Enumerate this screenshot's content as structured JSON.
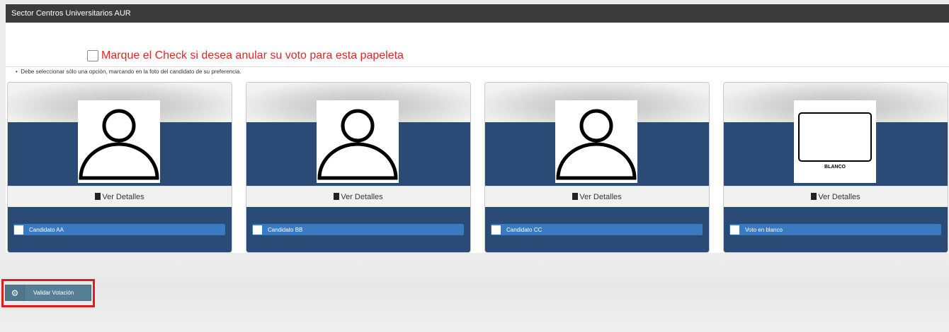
{
  "panel": {
    "title": "Sector Centros Universitarios AUR"
  },
  "annul": {
    "label": "Marque el Check si desea anular su voto para esta papeleta",
    "checked": false
  },
  "note": "Debe seleccionar sólo una opción, marcando en la foto del candidato de su preferencia.",
  "cards": [
    {
      "details_label": "Ver Detalles",
      "option_label": "Candidato AA",
      "photo_icon": "person-avatar-icon"
    },
    {
      "details_label": "Ver Detalles",
      "option_label": "Candidato BB",
      "photo_icon": "person-avatar-icon"
    },
    {
      "details_label": "Ver Detalles",
      "option_label": "Candidato CC",
      "photo_icon": "person-avatar-icon"
    },
    {
      "details_label": "Ver Detalles",
      "option_label": "Voto en blanco",
      "photo_icon": "blank-ballot-icon",
      "photo_text": "BLANCO"
    }
  ],
  "actions": {
    "validate_label": "Validar Votación",
    "validate_icon": "gear-icon"
  },
  "colors": {
    "header": "#3b3b3b",
    "navy": "#2a4b76",
    "option_blue": "#3a7ac0",
    "annul_red": "#e02828",
    "button": "#567f96",
    "highlight": "#e01b1b"
  }
}
